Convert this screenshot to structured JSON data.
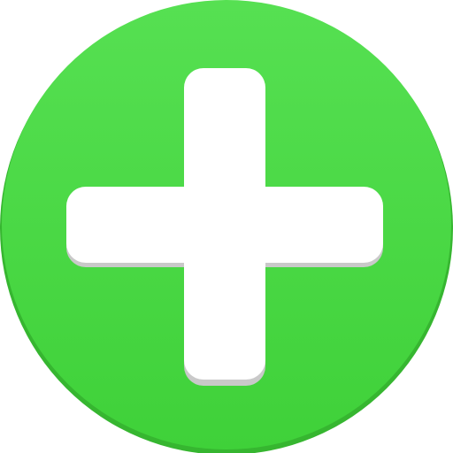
{
  "icon": {
    "name": "plus-icon",
    "action": "add",
    "colors": {
      "circle_top": "#56e052",
      "circle_bottom": "#3fd139",
      "circle_rim": "#36b630",
      "plus_fill": "#ffffff",
      "plus_shadow": "#c9c9c9"
    }
  }
}
